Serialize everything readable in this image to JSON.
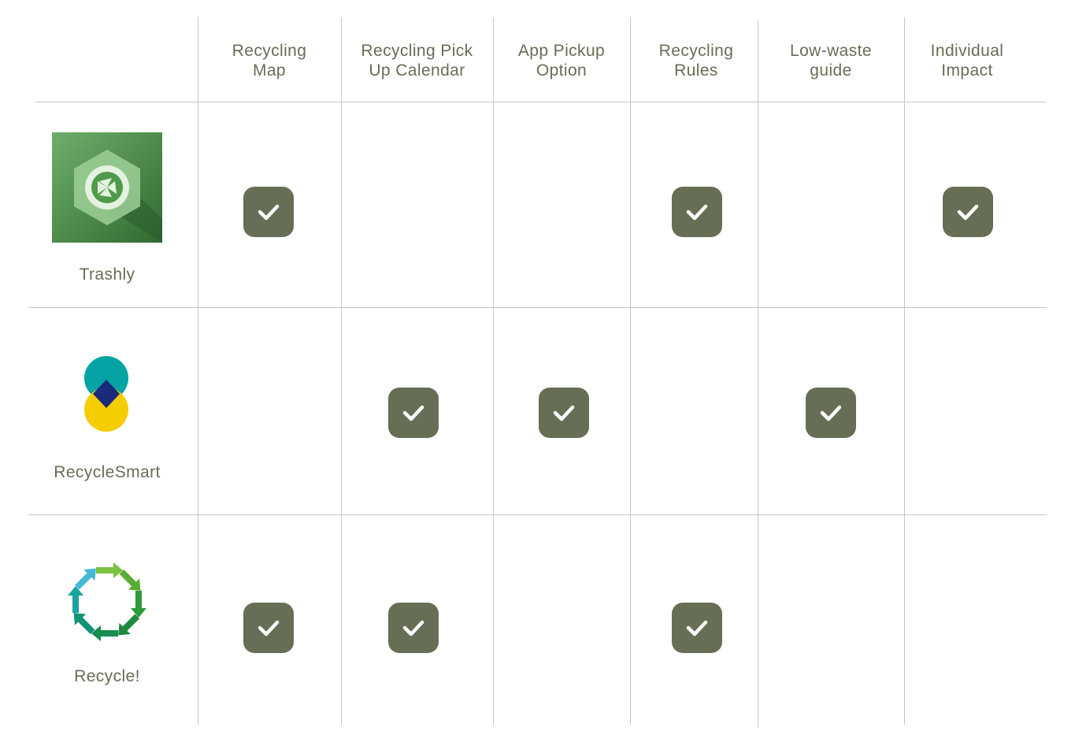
{
  "columns": [
    {
      "line1": "Recycling",
      "line2": "Map"
    },
    {
      "line1": "Recycling Pick",
      "line2": "Up Calendar"
    },
    {
      "line1": "App Pickup",
      "line2": "Option"
    },
    {
      "line1": "Recycling",
      "line2": "Rules"
    },
    {
      "line1": "Low-waste",
      "line2": "guide"
    },
    {
      "line1": "Individual",
      "line2": "Impact"
    }
  ],
  "apps": [
    {
      "name": "Trashly",
      "logo": "recycle-icon-green-square",
      "features": [
        true,
        false,
        false,
        true,
        false,
        true
      ]
    },
    {
      "name": "RecycleSmart",
      "logo": "overlapping-circles-logo",
      "features": [
        false,
        true,
        true,
        false,
        true,
        false
      ]
    },
    {
      "name": "Recycle!",
      "logo": "circular-arrows-logo",
      "features": [
        true,
        true,
        false,
        true,
        false,
        false
      ]
    }
  ],
  "colors": {
    "text": "#676e56",
    "check_bg": "#676e56",
    "grid_line": "#c6c6c6"
  }
}
